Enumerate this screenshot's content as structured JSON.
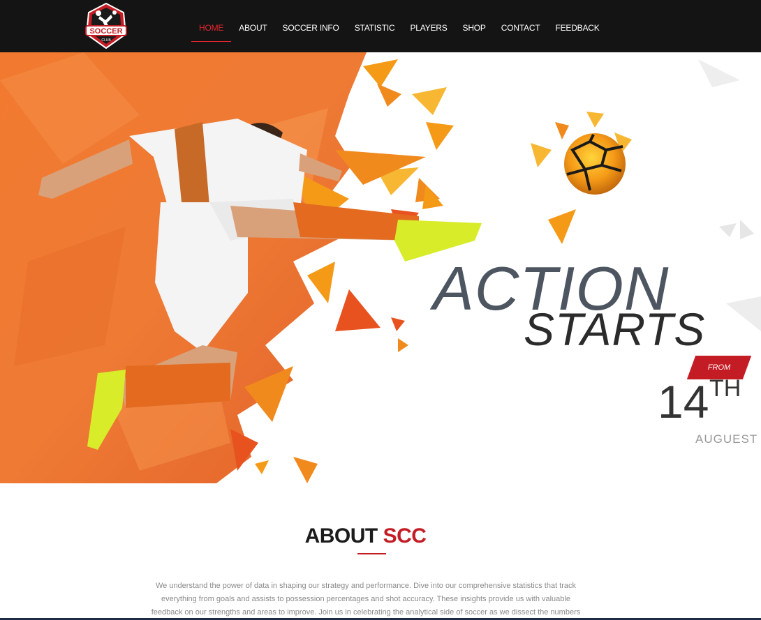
{
  "brand": {
    "logo_text": "SOCCER",
    "logo_subtext": "CLUB",
    "colors": {
      "accent": "#c41c24",
      "nav_bg": "#141414",
      "hero_orange": "#f07a2c"
    }
  },
  "nav": {
    "items": [
      {
        "label": "HOME",
        "active": true
      },
      {
        "label": "ABOUT"
      },
      {
        "label": "SOCCER INFO"
      },
      {
        "label": "STATISTIC"
      },
      {
        "label": "PLAYERS"
      },
      {
        "label": "SHOP"
      },
      {
        "label": "CONTACT"
      },
      {
        "label": "FEEDBACK"
      }
    ]
  },
  "hero": {
    "headline_line1": "ACTION",
    "headline_line2": "STARTS",
    "from_label": "FROM",
    "date_day": "14",
    "date_suffix": "TH",
    "date_month": "AUGUEST ,"
  },
  "about": {
    "title_main": "ABOUT",
    "title_accent": "SCC",
    "body": "We understand the power of data in shaping our strategy and performance. Dive into our comprehensive statistics that track everything from goals and assists to possession percentages and shot accuracy. These insights provide us with valuable feedback on our strengths and areas to improve. Join us in celebrating the analytical side of soccer as we dissect the numbers"
  }
}
